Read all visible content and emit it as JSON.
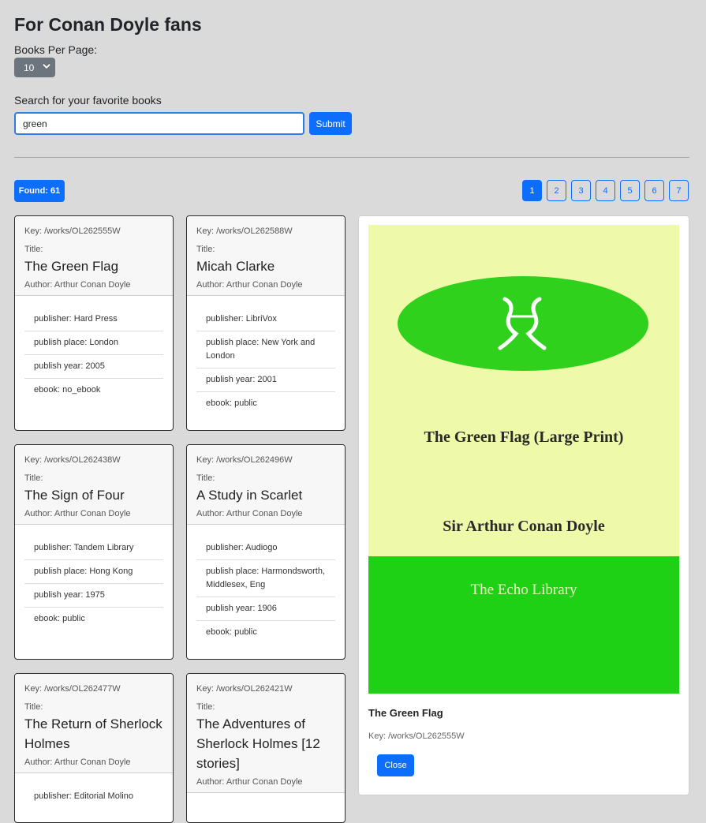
{
  "header": {
    "title": "For Conan Doyle fans"
  },
  "per_page": {
    "label": "Books Per Page:",
    "value": "10"
  },
  "search": {
    "label": "Search for your favorite books",
    "value": "green",
    "submit_label": "Submit"
  },
  "results": {
    "found_label": "Found: 61",
    "pages": [
      "1",
      "2",
      "3",
      "4",
      "5",
      "6",
      "7"
    ],
    "active_page": "1"
  },
  "books": [
    {
      "key": "Key: /works/OL262555W",
      "title_label": "Title:",
      "title": "The Green Flag",
      "author": "Author: Arthur Conan Doyle",
      "details": [
        "publisher: Hard Press",
        "publish place: London",
        "publish year: 2005",
        "ebook: no_ebook"
      ]
    },
    {
      "key": "Key: /works/OL262588W",
      "title_label": "Title:",
      "title": "Micah Clarke",
      "author": "Author: Arthur Conan Doyle",
      "details": [
        "publisher: LibriVox",
        "publish place: New York and London",
        "publish year: 2001",
        "ebook: public"
      ]
    },
    {
      "key": "Key: /works/OL262438W",
      "title_label": "Title:",
      "title": "The Sign of Four",
      "author": "Author: Arthur Conan Doyle",
      "details": [
        "publisher: Tandem Library",
        "publish place: Hong Kong",
        "publish year: 1975",
        "ebook: public"
      ]
    },
    {
      "key": "Key: /works/OL262496W",
      "title_label": "Title:",
      "title": "A Study in Scarlet",
      "author": "Author: Arthur Conan Doyle",
      "details": [
        "publisher: Audiogo",
        "publish place: Harmondsworth, Middlesex, Eng",
        "publish year: 1906",
        "ebook: public"
      ]
    },
    {
      "key": "Key: /works/OL262477W",
      "title_label": "Title:",
      "title": "The Return of Sherlock Holmes",
      "author": "Author: Arthur Conan Doyle",
      "details": [
        "publisher: Editorial Molino"
      ]
    },
    {
      "key": "Key: /works/OL262421W",
      "title_label": "Title:",
      "title": "The Adventures of Sherlock Holmes [12 stories]",
      "author": "Author: Arthur Conan Doyle",
      "details": []
    }
  ],
  "preview": {
    "cover_title": "The Green Flag (Large Print)",
    "cover_author": "Sir Arthur Conan Doyle",
    "cover_publisher": "The Echo Library",
    "title": "The Green Flag",
    "key": "Key: /works/OL262555W",
    "close_label": "Close",
    "cover_colors": {
      "background": "#eef9aa",
      "ellipse": "#2fd11d",
      "band": "#1fd115"
    }
  },
  "icons": {
    "select_chevron": "chevron-down-icon",
    "cover_emblem": "emblem-icon"
  },
  "colors": {
    "primary": "#0d6efd",
    "page_bg": "#dadada",
    "select_bg": "#6c757d"
  }
}
